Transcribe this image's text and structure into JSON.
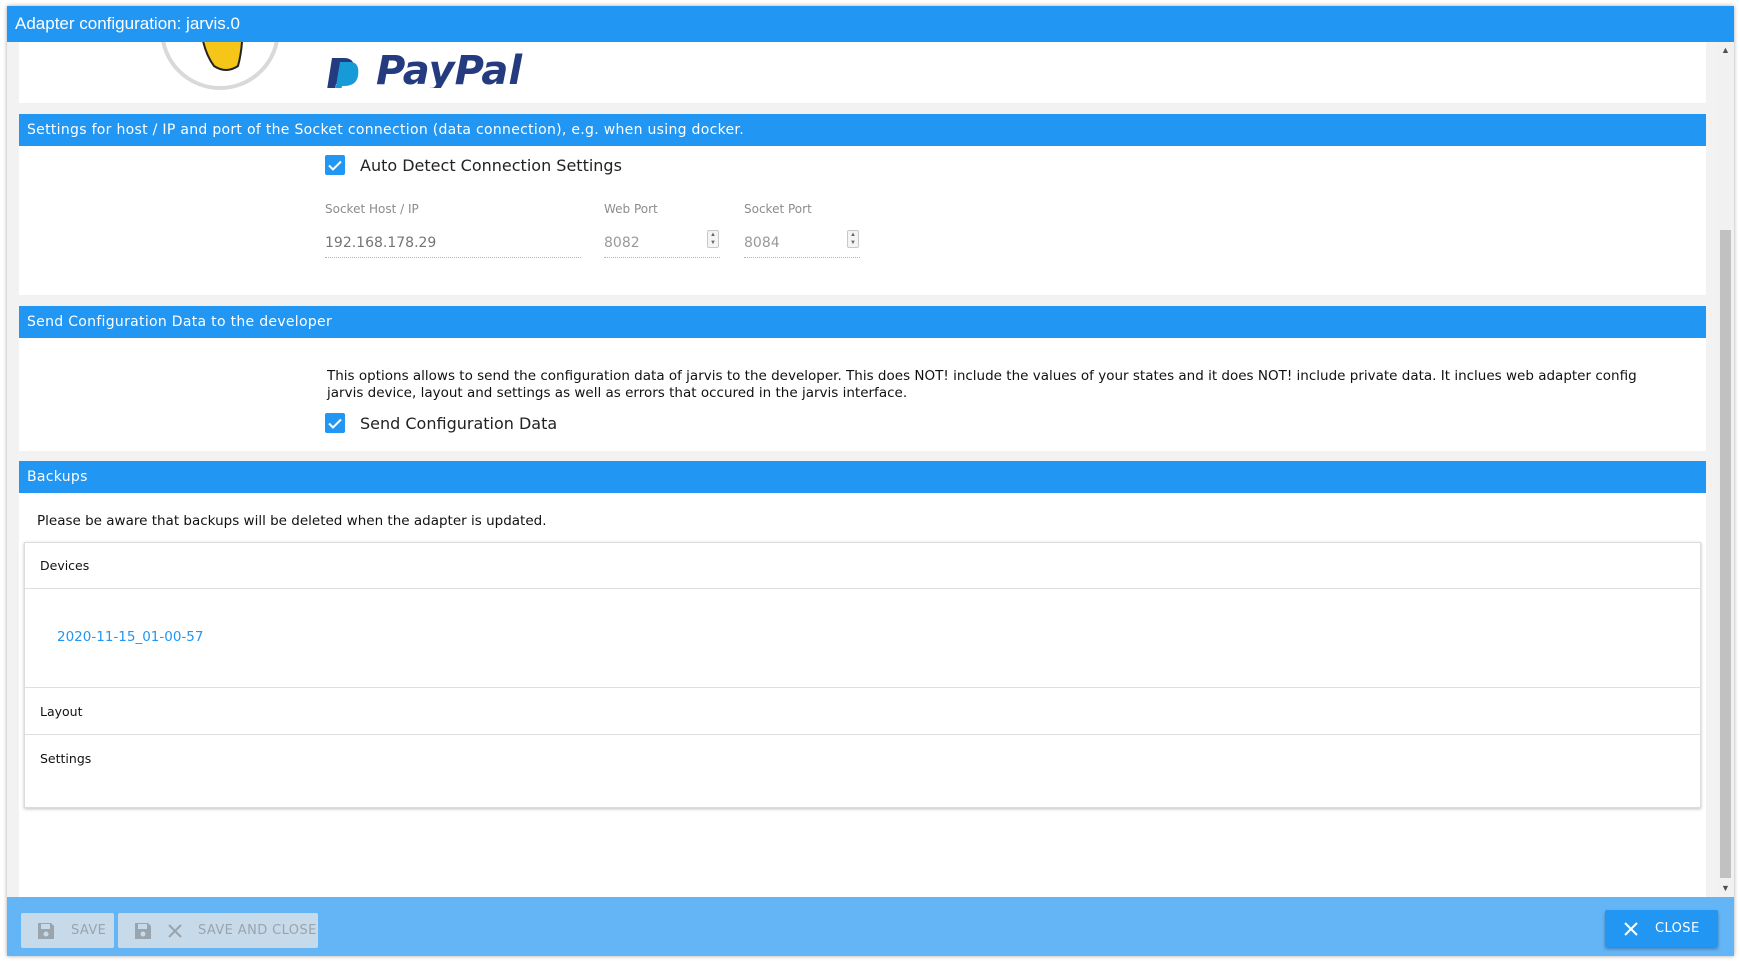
{
  "window": {
    "title": "Adapter configuration: jarvis.0"
  },
  "donate": {
    "paypal_text": "PayPal"
  },
  "socket_section": {
    "header": "Settings for host / IP and port of the Socket connection (data connection), e.g. when using docker.",
    "auto_detect_label": "Auto Detect Connection Settings",
    "auto_detect_checked": true,
    "fields": {
      "host": {
        "label": "Socket Host / IP",
        "placeholder": "192.168.178.29"
      },
      "web_port": {
        "label": "Web Port",
        "value": "8082"
      },
      "socket_port": {
        "label": "Socket Port",
        "value": "8084"
      }
    }
  },
  "config_section": {
    "header": "Send Configuration Data to the developer",
    "info_line1": "This options allows to send the configuration data of jarvis to the developer. This does NOT! include the values of your states and it does NOT! include private data. It inclues web adapter config",
    "info_line2": "jarvis device, layout and settings as well as errors that occured in the jarvis interface.",
    "send_label": "Send Configuration Data",
    "send_checked": true
  },
  "backups_section": {
    "header": "Backups",
    "note": "Please be aware that backups will be deleted when the adapter is updated.",
    "groups": {
      "devices": {
        "label": "Devices",
        "entries": [
          "2020-11-15_01-00-57"
        ]
      },
      "layout": {
        "label": "Layout"
      },
      "settings": {
        "label": "Settings"
      }
    }
  },
  "footer": {
    "save_label": "Save",
    "save_close_label": "Save and close",
    "close_label": "Close"
  },
  "colors": {
    "primary": "#2196f3",
    "footer_bg": "#64b5f6",
    "disabled_button": "#c6daea",
    "page_bg": "#f2f2f2"
  },
  "icons": {
    "checkbox": "check-icon",
    "save": "floppy-disk-icon",
    "close": "close-x-icon"
  }
}
